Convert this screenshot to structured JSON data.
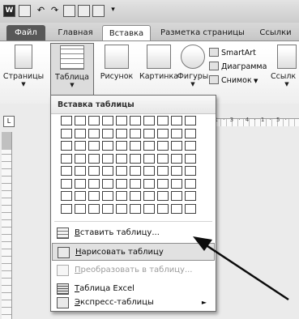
{
  "tabs": [
    {
      "label": "Файл"
    },
    {
      "label": "Главная"
    },
    {
      "label": "Вставка"
    },
    {
      "label": "Разметка страницы"
    },
    {
      "label": "Ссылки"
    }
  ],
  "ribbon": {
    "pages": {
      "label": "Страницы"
    },
    "table": {
      "label": "Таблица"
    },
    "picture": {
      "label": "Рисунок"
    },
    "clipart": {
      "label": "Картинка"
    },
    "shapes": {
      "label": "Фигуры"
    },
    "smartart": {
      "label": "SmartArt"
    },
    "chart": {
      "label": "Диаграмма"
    },
    "screenshot": {
      "label": "Снимок"
    },
    "links": {
      "label": "Ссылк"
    }
  },
  "ruler": {
    "ticks": "· 1 · 3 · 4 · 1 · 5 ·"
  },
  "menu": {
    "header": "Вставка таблицы",
    "grid": {
      "cols": 10,
      "rows": 8
    },
    "items": [
      {
        "label": "Вставить таблицу...",
        "icon": "insert-table-icon"
      },
      {
        "label": "Нарисовать таблицу",
        "icon": "draw-table-icon"
      },
      {
        "label": "Преобразовать в таблицу...",
        "icon": "convert-table-icon"
      },
      {
        "label": "Таблица Excel",
        "icon": "excel-table-icon"
      },
      {
        "label": "Экспресс-таблицы",
        "icon": "quick-tables-icon"
      }
    ]
  }
}
